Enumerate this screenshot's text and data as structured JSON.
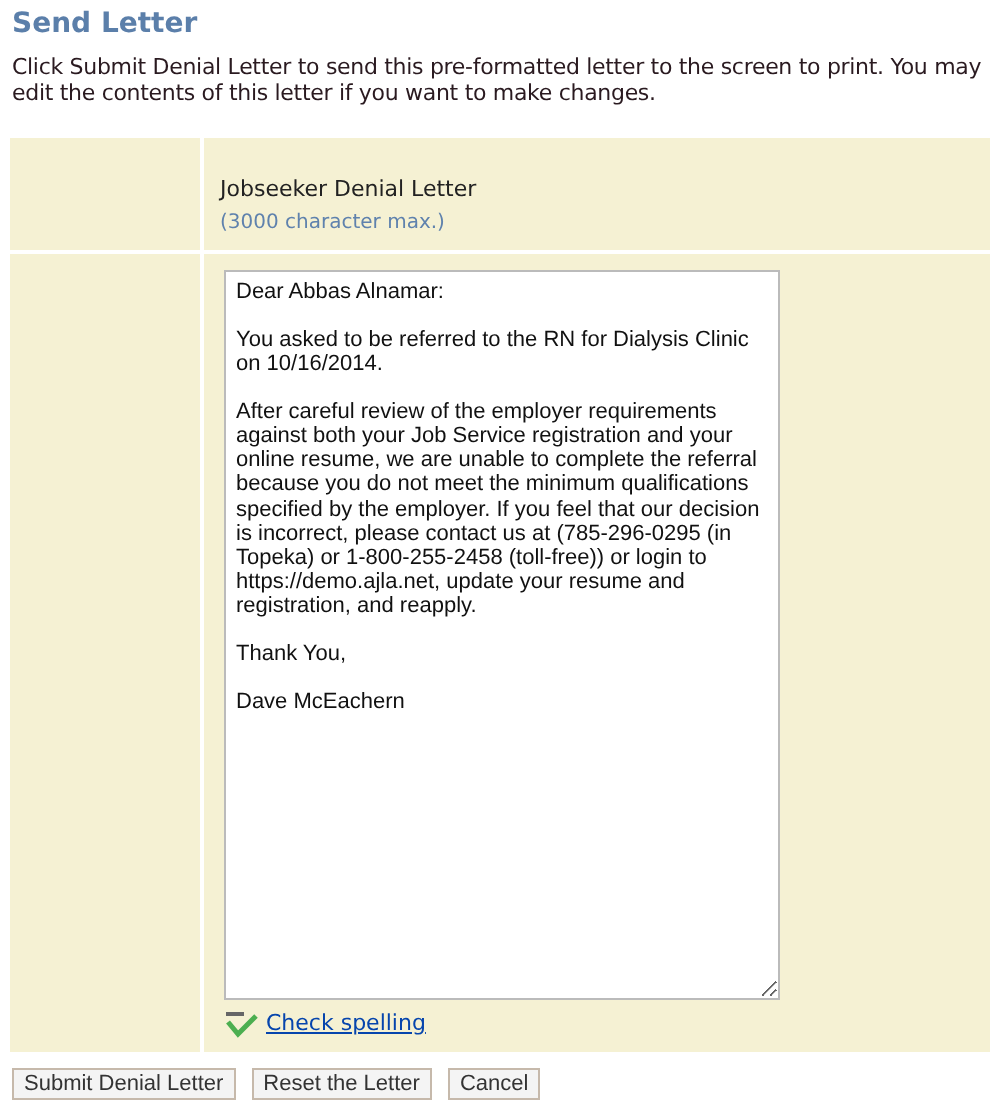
{
  "page_title": "Send Letter",
  "instructions": "Click Submit Denial Letter to send this pre-formatted letter to the screen to print. You may edit the contents of this letter if you want to make changes.",
  "letter": {
    "label": "Jobseeker Denial Letter",
    "hint": "(3000 character max.)",
    "value": "Dear Abbas Alnamar:\n\nYou asked to be referred to the RN for Dialysis Clinic on 10/16/2014.\n\nAfter careful review of the employer requirements against both your Job Service registration and your online resume, we are unable to complete the referral because you do not meet the minimum qualifications specified by the employer. If you feel that our decision is incorrect, please contact us at (785-296-0295 (in Topeka) or 1-800-255-2458 (toll-free)) or login to https://demo.ajla.net, update your resume and registration, and reapply.\n\nThank You,\n\nDave McEachern",
    "spell_link": "Check spelling"
  },
  "buttons": [
    "Submit Denial Letter",
    "Reset the Letter",
    "Cancel"
  ]
}
